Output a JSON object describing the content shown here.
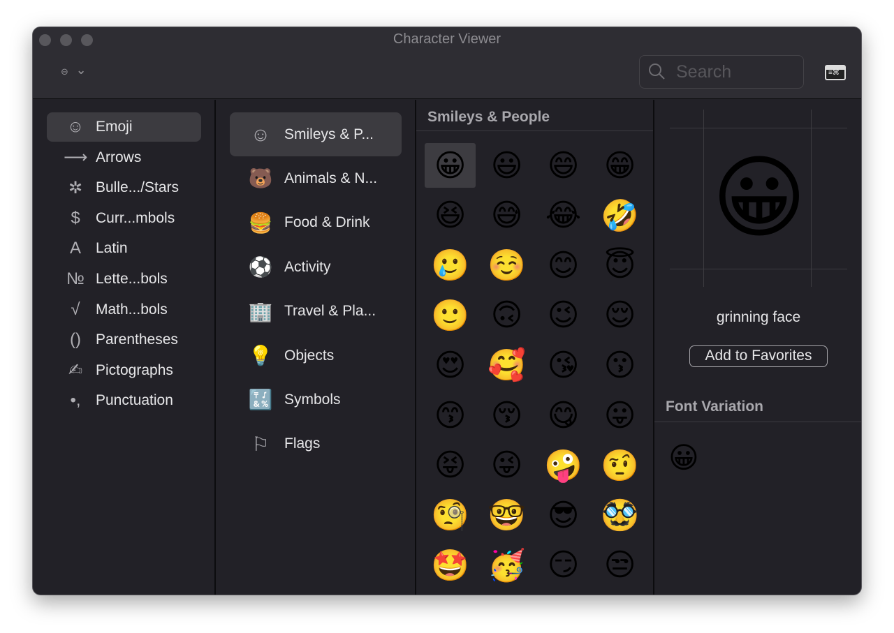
{
  "window": {
    "title": "Character Viewer",
    "filter_icon": "customize-list-icon",
    "search_placeholder": "Search",
    "keyboard_icon": "keyboard-viewer-icon"
  },
  "categories": [
    {
      "glyph": "☺",
      "label": "Emoji",
      "selected": true
    },
    {
      "glyph": "⟶",
      "label": "Arrows"
    },
    {
      "glyph": "✲",
      "label": "Bulle.../Stars"
    },
    {
      "glyph": "$",
      "label": "Curr...mbols"
    },
    {
      "glyph": "A",
      "label": "Latin"
    },
    {
      "glyph": "№",
      "label": "Lette...bols"
    },
    {
      "glyph": "√",
      "label": "Math...bols"
    },
    {
      "glyph": "()",
      "label": "Parentheses"
    },
    {
      "glyph": "✍",
      "label": "Pictographs"
    },
    {
      "glyph": "•,",
      "label": "Punctuation"
    }
  ],
  "subcategories": [
    {
      "glyph": "☺",
      "label": "Smileys & P...",
      "selected": true
    },
    {
      "glyph": "🐻",
      "label": "Animals & N..."
    },
    {
      "glyph": "🍔",
      "label": "Food & Drink"
    },
    {
      "glyph": "⚽",
      "label": "Activity"
    },
    {
      "glyph": "🏢",
      "label": "Travel & Pla..."
    },
    {
      "glyph": "💡",
      "label": "Objects"
    },
    {
      "glyph": "🔣",
      "label": "Symbols"
    },
    {
      "glyph": "⚐",
      "label": "Flags"
    }
  ],
  "grid": {
    "section": "Smileys & People",
    "emojis": [
      "😀",
      "😃",
      "😄",
      "😁",
      "😆",
      "😅",
      "😂",
      "🤣",
      "🥲",
      "☺️",
      "😊",
      "😇",
      "🙂",
      "🙃",
      "😉",
      "😌",
      "😍",
      "🥰",
      "😘",
      "😗",
      "😙",
      "😚",
      "😋",
      "😛",
      "😝",
      "😜",
      "🤪",
      "🤨",
      "🧐",
      "🤓",
      "😎",
      "🥸",
      "🤩",
      "🥳",
      "😏",
      "😒"
    ]
  },
  "detail": {
    "char": "😀",
    "name": "grinning face",
    "favorites_button": "Add to Favorites",
    "font_variation_heading": "Font Variation",
    "variations": [
      "😀"
    ]
  }
}
